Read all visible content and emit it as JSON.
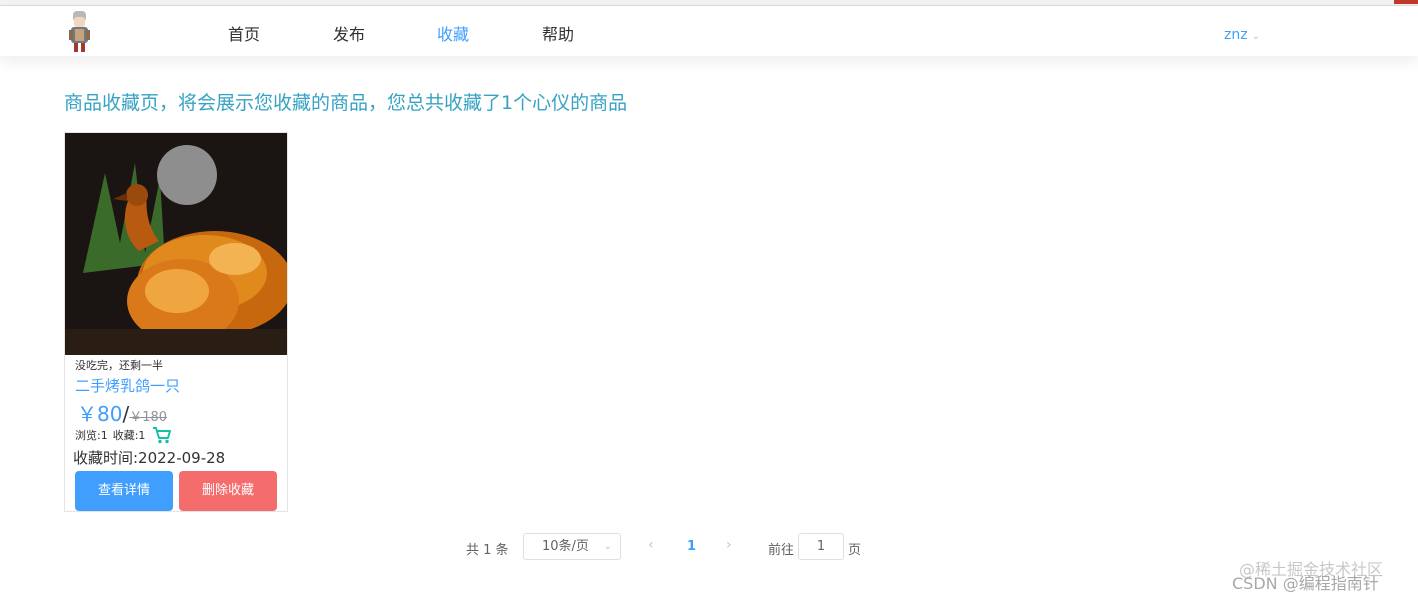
{
  "nav": {
    "items": [
      {
        "label": "首页"
      },
      {
        "label": "发布"
      },
      {
        "label": "收藏"
      },
      {
        "label": "帮助"
      }
    ],
    "active_index": 2,
    "user": "znz"
  },
  "banner": "商品收藏页，将会展示您收藏的商品，您总共收藏了1个心仪的商品",
  "card": {
    "description": "没吃完，还剩一半",
    "name": "二手烤乳鸽一只",
    "price": "￥80",
    "price_sep": "/",
    "original_price": "￥180",
    "views": "浏览:1",
    "favorites": "收藏:1",
    "favorite_time": "收藏时间:2022-09-28",
    "detail_button": "查看详情",
    "remove_button": "删除收藏"
  },
  "pagination": {
    "total": "共 1 条",
    "page_size": "10条/页",
    "current_page": "1",
    "goto_label": "前往",
    "goto_value": "1",
    "goto_suffix": "页"
  },
  "watermark": {
    "line1": "@稀土掘金技术社区",
    "line2": "CSDN @编程指南针"
  },
  "colors": {
    "primary": "#409eff",
    "danger": "#f56c6c",
    "banner": "#36a3c4",
    "cart": "#13c2a3"
  }
}
